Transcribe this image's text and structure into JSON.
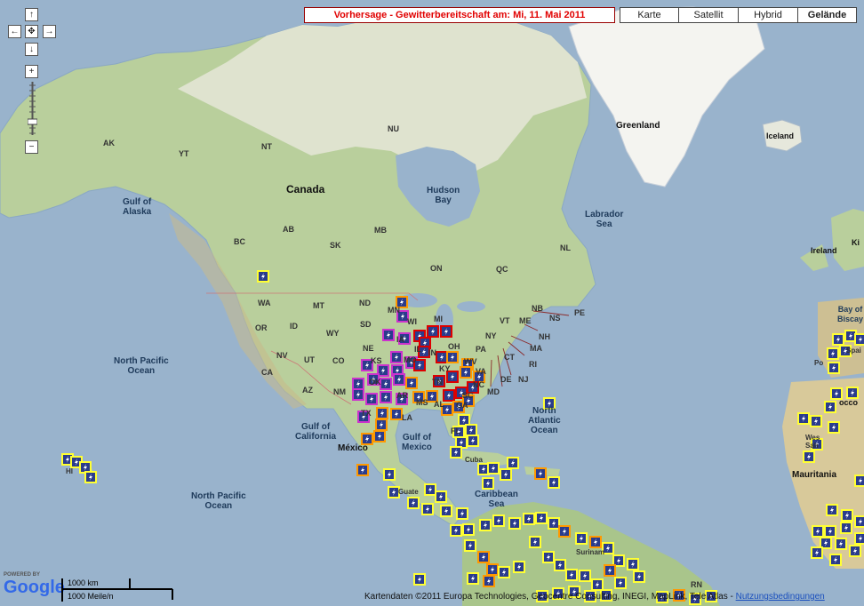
{
  "forecast_title": "Vorhersage - Gewitterbereitschaft am: Mi, 11. Mai 2011",
  "map_types": [
    {
      "label": "Karte",
      "selected": false
    },
    {
      "label": "Satellit",
      "selected": false
    },
    {
      "label": "Hybrid",
      "selected": false
    },
    {
      "label": "Gelände",
      "selected": true
    }
  ],
  "controls": {
    "pan_up": "↑",
    "pan_left": "←",
    "pan_center": "✥",
    "pan_right": "→",
    "pan_down": "↓",
    "zoom_in": "+",
    "zoom_out": "−"
  },
  "colors": {
    "ocean": "#99b3cc",
    "land_green": "#b7cf9b",
    "land_dark": "#8fb27a",
    "arctic": "#f4f4f0",
    "icon_bg": "#2b3c8c",
    "low_border": "#ffff33",
    "mid_border": "#ff9900",
    "high_border": "#dd0000",
    "severe_border": "#cc33cc"
  },
  "labels": {
    "canada": "Canada",
    "greenland": "Greenland",
    "iceland": "Iceland",
    "hudson_bay": "Hudson\nBay",
    "labrador_sea": "Labrador\nSea",
    "gulf_alaska": "Gulf of\nAlaska",
    "n_pacific_1": "North Pacific\nOcean",
    "n_pacific_2": "North Pacific\nOcean",
    "n_atlantic": "North\nAtlantic\nOcean",
    "gulf_mexico": "Gulf of\nMexico",
    "gulf_california": "Gulf of\nCalifornia",
    "caribbean": "Caribbean\nSea",
    "bay_biscay": "Bay of\nBiscay",
    "mexico": "México",
    "mauritania": "Mauritania",
    "ireland": "Ireland",
    "kingdom": "Ki",
    "guate": "Guate",
    "cuba": "Cuba",
    "surinam": "Surinam",
    "morocco": "occo",
    "western_sahara": "Wes\nSah",
    "portugal": "Po",
    "spain": "Spai",
    "rn": "RN",
    "hi": "HI",
    "ne": "NE",
    "ks": "KS",
    "mo": "MO",
    "ga": "GA",
    "wv": "WV",
    "mi": "MI"
  },
  "states": [
    "AK",
    "YT",
    "NT",
    "NU",
    "BC",
    "AB",
    "SK",
    "MB",
    "ON",
    "QC",
    "NL",
    "NB",
    "NS",
    "PE",
    "WA",
    "OR",
    "ID",
    "MT",
    "WY",
    "NV",
    "UT",
    "CA",
    "AZ",
    "NM",
    "CO",
    "TX",
    "ND",
    "SD",
    "MN",
    "VT",
    "ME",
    "NH",
    "MA",
    "NY",
    "CT",
    "RI",
    "PA",
    "NJ",
    "DE",
    "MD",
    "VA",
    "NC",
    "SC",
    "KY",
    "TN",
    "LA",
    "MS",
    "AL",
    "OK",
    "IA",
    "IL",
    "IN",
    "OH",
    "WI",
    "FL",
    "AR"
  ],
  "scale": {
    "km": "1000 km",
    "mi": "1000 Meile/n"
  },
  "logo": {
    "powered": "POWERED BY",
    "brand": "Google"
  },
  "attribution": {
    "text": "Kartendaten ©2011 Europa Technologies, Geocentre Consulting, INEGI, MapLink, Tele Atlas - ",
    "link": "Nutzungsbedingungen"
  },
  "storm_levels": [
    "low",
    "mid",
    "high",
    "severe"
  ]
}
